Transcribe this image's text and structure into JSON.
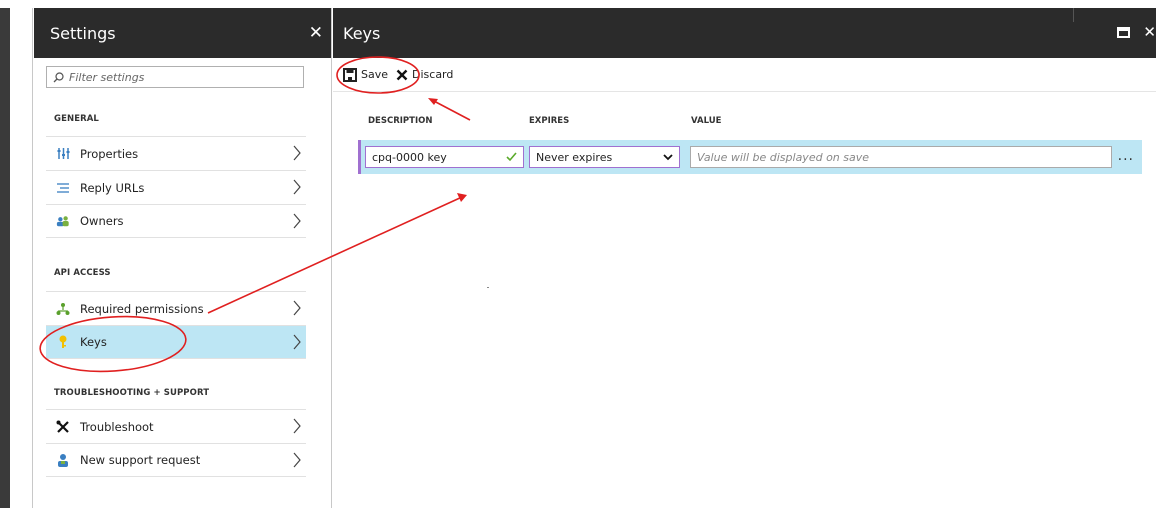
{
  "settings": {
    "title": "Settings",
    "close_glyph": "✕",
    "filter_placeholder": "Filter settings",
    "sections": [
      {
        "label": "GENERAL",
        "items": [
          {
            "label": "Properties",
            "icon": "properties-icon"
          },
          {
            "label": "Reply URLs",
            "icon": "reply-urls-icon"
          },
          {
            "label": "Owners",
            "icon": "owners-icon"
          }
        ]
      },
      {
        "label": "API ACCESS",
        "items": [
          {
            "label": "Required permissions",
            "icon": "permissions-icon"
          },
          {
            "label": "Keys",
            "icon": "key-icon",
            "selected": true
          }
        ]
      },
      {
        "label": "TROUBLESHOOTING + SUPPORT",
        "items": [
          {
            "label": "Troubleshoot",
            "icon": "tools-icon"
          },
          {
            "label": "New support request",
            "icon": "support-icon"
          }
        ]
      }
    ]
  },
  "keys": {
    "title": "Keys",
    "close_glyph": "✕",
    "toolbar": {
      "save_label": "Save",
      "discard_label": "Discard"
    },
    "columns": {
      "description": "DESCRIPTION",
      "expires": "EXPIRES",
      "value": "VALUE"
    },
    "row": {
      "description": "cpq-0000 key",
      "expires": "Never expires",
      "value_placeholder": "Value will be displayed on save",
      "more_glyph": "..."
    }
  },
  "colors": {
    "header_bg": "#2b2b2b",
    "selected_bg": "#bde6f4",
    "row_accent": "#a070d0",
    "annotation_red": "#e02020",
    "check_green": "#5aaa2a"
  }
}
